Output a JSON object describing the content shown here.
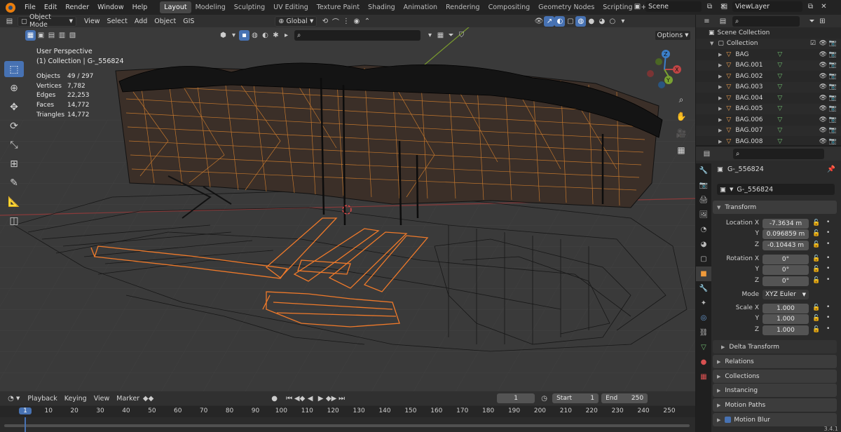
{
  "menu": {
    "file": "File",
    "edit": "Edit",
    "render": "Render",
    "window": "Window",
    "help": "Help"
  },
  "workspaces": [
    "Layout",
    "Modeling",
    "Sculpting",
    "UV Editing",
    "Texture Paint",
    "Shading",
    "Animation",
    "Rendering",
    "Compositing",
    "Geometry Nodes",
    "Scripting"
  ],
  "scene": {
    "label": "Scene",
    "view_layer": "ViewLayer"
  },
  "viewport_header": {
    "mode": "Object Mode",
    "view": "View",
    "select": "Select",
    "add": "Add",
    "object": "Object",
    "gis": "GIS",
    "orientation": "Global",
    "options": "Options"
  },
  "overlay_text": {
    "perspective": "User Perspective",
    "collection_line": "(1) Collection | G-_556824"
  },
  "stats": [
    {
      "label": "Objects",
      "value": "49 / 297"
    },
    {
      "label": "Vertices",
      "value": "7,782"
    },
    {
      "label": "Edges",
      "value": "22,253"
    },
    {
      "label": "Faces",
      "value": "14,772"
    },
    {
      "label": "Triangles",
      "value": "14,772"
    }
  ],
  "gizmo": {
    "x": "X",
    "y": "Y",
    "z": "Z"
  },
  "timeline": {
    "playback": "Playback",
    "keying": "Keying",
    "view": "View",
    "marker": "Marker",
    "current_frame": "1",
    "start_label": "Start",
    "start": "1",
    "end_label": "End",
    "end": "250",
    "ticks": [
      "1",
      "10",
      "20",
      "30",
      "40",
      "50",
      "60",
      "70",
      "80",
      "90",
      "100",
      "110",
      "120",
      "130",
      "140",
      "150",
      "160",
      "170",
      "180",
      "190",
      "200",
      "210",
      "220",
      "230",
      "240",
      "250"
    ]
  },
  "outliner": {
    "scene_collection": "Scene Collection",
    "collection": "Collection",
    "items": [
      "BAG",
      "BAG.001",
      "BAG.002",
      "BAG.003",
      "BAG.004",
      "BAG.005",
      "BAG.006",
      "BAG.007",
      "BAG.008"
    ]
  },
  "properties": {
    "object_name": "G-_556824",
    "data_name": "G-_556824",
    "transform": "Transform",
    "location_label": "Location X",
    "location": [
      "-7.3634 m",
      "0.096859 m",
      "-0.10443 m"
    ],
    "rotation_label": "Rotation X",
    "rotation": [
      "0°",
      "0°",
      "0°"
    ],
    "y": "Y",
    "z": "Z",
    "mode_label": "Mode",
    "mode": "XYZ Euler",
    "scale_label": "Scale X",
    "scale": [
      "1.000",
      "1.000",
      "1.000"
    ],
    "delta_transform": "Delta Transform",
    "panels": [
      "Relations",
      "Collections",
      "Instancing",
      "Motion Paths",
      "Motion Blur"
    ]
  },
  "version": "3.4.1",
  "colors": {
    "accent": "#4772b3",
    "selected": "#e8722a",
    "wire": "#0e0e0e",
    "viewport_bg": "#3a3a3a"
  }
}
